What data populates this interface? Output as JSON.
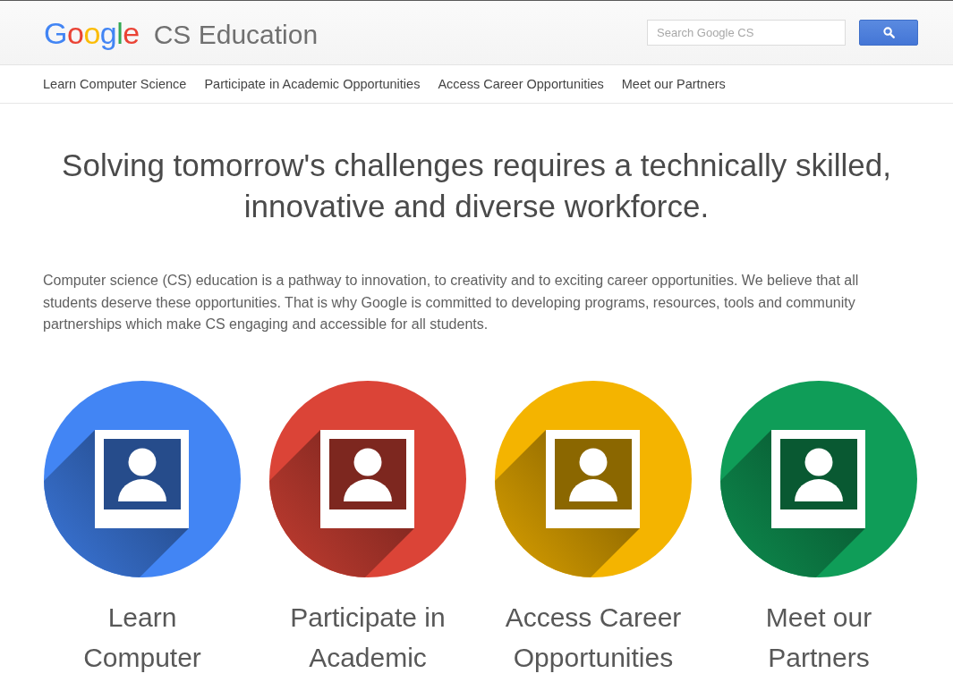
{
  "header": {
    "logo": "Google",
    "site_title": "CS Education",
    "search": {
      "placeholder": "Search Google CS"
    }
  },
  "nav": [
    "Learn Computer Science",
    "Participate in Academic Opportunities",
    "Access Career Opportunities",
    "Meet our Partners"
  ],
  "headline": "Solving tomorrow's challenges requires a technically skilled, innovative and diverse workforce.",
  "intro": "Computer science (CS) education is a pathway to innovation, to creativity and to exciting career opportunities. We believe that all students deserve these opportunities. That is why Google is committed to developing programs, resources, tools and community partnerships which make CS engaging and accessible for all students.",
  "cards": [
    {
      "title": "Learn Computer",
      "color": "#4285f4"
    },
    {
      "title": "Participate in Academic",
      "color": "#db4437"
    },
    {
      "title": "Access Career Opportunities",
      "color": "#f4b400"
    },
    {
      "title": "Meet our Partners",
      "color": "#0f9d58"
    }
  ]
}
